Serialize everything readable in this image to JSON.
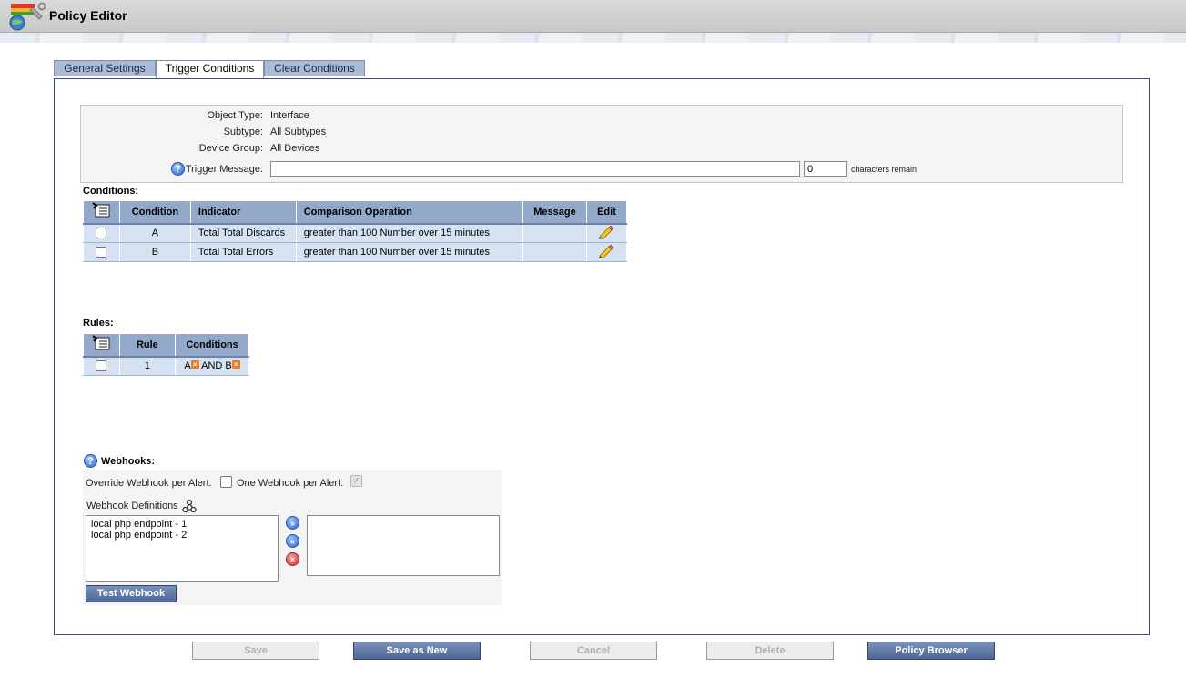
{
  "window": {
    "title": "Policy Editor"
  },
  "tabs": [
    {
      "label": "General Settings",
      "active": false
    },
    {
      "label": "Trigger Conditions",
      "active": true
    },
    {
      "label": "Clear Conditions",
      "active": false
    }
  ],
  "info": {
    "object_type_label": "Object Type:",
    "object_type_value": "Interface",
    "subtype_label": "Subtype:",
    "subtype_value": "All Subtypes",
    "device_group_label": "Device Group:",
    "device_group_value": "All Devices",
    "trigger_message_label": "Trigger Message:",
    "trigger_message_value": "",
    "chars_count": "0",
    "chars_remain_label": "characters remain"
  },
  "conditions": {
    "title": "Conditions:",
    "headers": [
      "Condition",
      "Indicator",
      "Comparison Operation",
      "Message",
      "Edit"
    ],
    "rows": [
      {
        "condition": "A",
        "indicator": "Total Total Discards",
        "comparison": "greater than 100 Number over 15 minutes",
        "message": ""
      },
      {
        "condition": "B",
        "indicator": "Total Total Errors",
        "comparison": "greater than 100 Number over 15 minutes",
        "message": ""
      }
    ]
  },
  "rules": {
    "title": "Rules:",
    "headers": [
      "Rule",
      "Conditions"
    ],
    "rows": [
      {
        "rule": "1",
        "cond_a": "A",
        "and": "AND",
        "cond_b": "B"
      }
    ]
  },
  "webhooks": {
    "title": "Webhooks:",
    "override_label": "Override Webhook per Alert:",
    "override_checked": false,
    "one_per_alert_label": "One Webhook per Alert:",
    "one_per_alert_checked": true,
    "definitions_label": "Webhook Definitions",
    "available": [
      "local php endpoint - 1",
      "local php endpoint - 2"
    ],
    "selected": [],
    "test_button": "Test Webhook"
  },
  "footer": {
    "save": "Save",
    "save_as_new": "Save as New",
    "cancel": "Cancel",
    "delete": "Delete",
    "policy_browser": "Policy Browser"
  },
  "colors": {
    "tab_inactive": "#a9bbd6",
    "table_header": "#93a9c9",
    "table_row": "#d6e2f2",
    "button_blue": "#5a72a3",
    "panel_border": "#3c4a86"
  }
}
